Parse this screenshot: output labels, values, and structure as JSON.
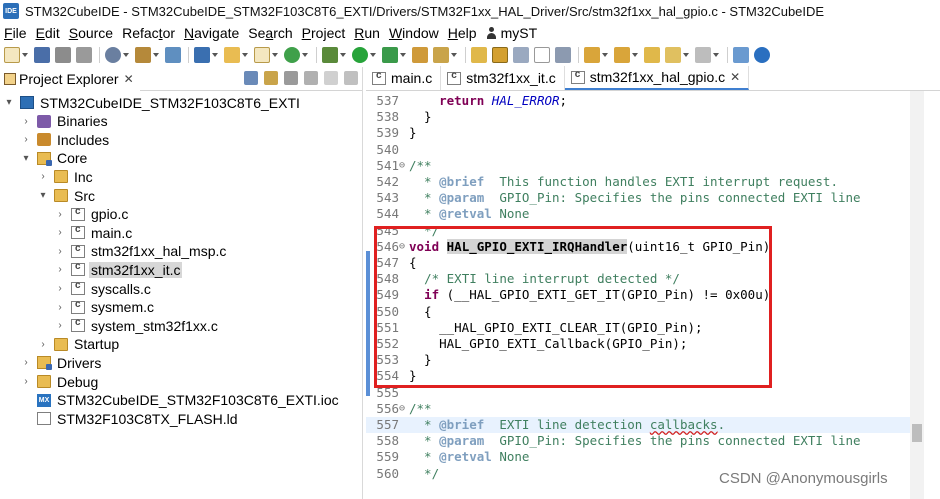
{
  "window": {
    "logo_text": "IDE",
    "title": "STM32CubeIDE - STM32CubeIDE_STM32F103C8T6_EXTI/Drivers/STM32F1xx_HAL_Driver/Src/stm32f1xx_hal_gpio.c - STM32CubeIDE"
  },
  "menu": [
    {
      "u": "F",
      "rest": "ile"
    },
    {
      "u": "E",
      "rest": "dit"
    },
    {
      "u": "S",
      "rest": "ource"
    },
    {
      "pre": "Refac",
      "u": "t",
      "rest": "or"
    },
    {
      "u": "N",
      "rest": "avigate"
    },
    {
      "pre": "Se",
      "u": "a",
      "rest": "rch"
    },
    {
      "u": "P",
      "rest": "roject"
    },
    {
      "u": "R",
      "rest": "un"
    },
    {
      "u": "W",
      "rest": "indow"
    },
    {
      "u": "H",
      "rest": "elp"
    }
  ],
  "menu_myst": "myST",
  "project_explorer": {
    "tab_label": "Project Explorer",
    "close": "✕",
    "tree": [
      {
        "label": "STM32CubeIDE_STM32F103C8T6_EXTI",
        "indent": 0,
        "arrow": "▾",
        "icon": "proj"
      },
      {
        "label": "Binaries",
        "indent": 1,
        "arrow": "›",
        "icon": "bin"
      },
      {
        "label": "Includes",
        "indent": 1,
        "arrow": "›",
        "icon": "inc"
      },
      {
        "label": "Core",
        "indent": 1,
        "arrow": "▾",
        "icon": "folder-src"
      },
      {
        "label": "Inc",
        "indent": 2,
        "arrow": "›",
        "icon": "folder"
      },
      {
        "label": "Src",
        "indent": 2,
        "arrow": "▾",
        "icon": "folder"
      },
      {
        "label": "gpio.c",
        "indent": 3,
        "arrow": "›",
        "icon": "cfile"
      },
      {
        "label": "main.c",
        "indent": 3,
        "arrow": "›",
        "icon": "cfile"
      },
      {
        "label": "stm32f1xx_hal_msp.c",
        "indent": 3,
        "arrow": "›",
        "icon": "cfile"
      },
      {
        "label": "stm32f1xx_it.c",
        "indent": 3,
        "arrow": "›",
        "icon": "cfile",
        "selected": true
      },
      {
        "label": "syscalls.c",
        "indent": 3,
        "arrow": "›",
        "icon": "cfile"
      },
      {
        "label": "sysmem.c",
        "indent": 3,
        "arrow": "›",
        "icon": "cfile"
      },
      {
        "label": "system_stm32f1xx.c",
        "indent": 3,
        "arrow": "›",
        "icon": "cfile"
      },
      {
        "label": "Startup",
        "indent": 2,
        "arrow": "›",
        "icon": "folder"
      },
      {
        "label": "Drivers",
        "indent": 1,
        "arrow": "›",
        "icon": "folder-src"
      },
      {
        "label": "Debug",
        "indent": 1,
        "arrow": "›",
        "icon": "folder"
      },
      {
        "label": "STM32CubeIDE_STM32F103C8T6_EXTI.ioc",
        "indent": 1,
        "arrow": "",
        "icon": "mx"
      },
      {
        "label": "STM32F103C8TX_FLASH.ld",
        "indent": 1,
        "arrow": "",
        "icon": "ld"
      }
    ]
  },
  "editor_tabs": [
    {
      "label": "main.c",
      "active": false
    },
    {
      "label": "stm32f1xx_it.c",
      "active": false
    },
    {
      "label": "stm32f1xx_hal_gpio.c",
      "active": true,
      "close": "✕"
    }
  ],
  "code": [
    {
      "n": "537",
      "f": "",
      "t": [
        [
          "    ",
          ""
        ],
        [
          "return ",
          "kw"
        ],
        [
          "HAL_ERROR",
          "it"
        ],
        [
          ";",
          ""
        ]
      ]
    },
    {
      "n": "538",
      "f": "",
      "t": [
        [
          "  }",
          ""
        ]
      ]
    },
    {
      "n": "539",
      "f": "",
      "t": [
        [
          "}",
          ""
        ]
      ]
    },
    {
      "n": "540",
      "f": "",
      "t": [
        [
          "",
          ""
        ]
      ]
    },
    {
      "n": "541",
      "f": "⊖",
      "t": [
        [
          "/**",
          "cm"
        ]
      ]
    },
    {
      "n": "542",
      "f": "",
      "t": [
        [
          "  * ",
          "cm"
        ],
        [
          "@brief",
          "tag"
        ],
        [
          "  This function handles EXTI interrupt request.",
          "cm"
        ]
      ]
    },
    {
      "n": "543",
      "f": "",
      "t": [
        [
          "  * ",
          "cm"
        ],
        [
          "@param",
          "tag"
        ],
        [
          "  GPIO_Pin: Specifies the pins connected EXTI line",
          "cm"
        ]
      ]
    },
    {
      "n": "544",
      "f": "",
      "t": [
        [
          "  * ",
          "cm"
        ],
        [
          "@retval",
          "tag"
        ],
        [
          " None",
          "cm"
        ]
      ]
    },
    {
      "n": "545",
      "f": "",
      "t": [
        [
          "  */",
          "cm"
        ]
      ]
    },
    {
      "n": "546",
      "f": "⊖",
      "t": [
        [
          "void ",
          "kw"
        ],
        [
          "HAL_GPIO_EXTI_IRQHandler",
          "fnhl"
        ],
        [
          "(uint16_t GPIO_Pin)",
          ""
        ]
      ]
    },
    {
      "n": "547",
      "f": "",
      "t": [
        [
          "{",
          ""
        ]
      ]
    },
    {
      "n": "548",
      "f": "",
      "t": [
        [
          "  ",
          ""
        ],
        [
          "/* EXTI line interrupt detected */",
          "cm"
        ]
      ]
    },
    {
      "n": "549",
      "f": "",
      "t": [
        [
          "  ",
          ""
        ],
        [
          "if",
          "kw"
        ],
        [
          " (__HAL_GPIO_EXTI_GET_IT(GPIO_Pin) != 0x00u)",
          ""
        ]
      ]
    },
    {
      "n": "550",
      "f": "",
      "t": [
        [
          "  {",
          ""
        ]
      ]
    },
    {
      "n": "551",
      "f": "",
      "t": [
        [
          "    __HAL_GPIO_EXTI_CLEAR_IT(GPIO_Pin);",
          ""
        ]
      ]
    },
    {
      "n": "552",
      "f": "",
      "t": [
        [
          "    HAL_GPIO_EXTI_Callback(GPIO_Pin);",
          ""
        ]
      ]
    },
    {
      "n": "553",
      "f": "",
      "t": [
        [
          "  }",
          ""
        ]
      ]
    },
    {
      "n": "554",
      "f": "",
      "t": [
        [
          "}",
          ""
        ]
      ]
    },
    {
      "n": "555",
      "f": "",
      "t": [
        [
          "",
          ""
        ]
      ]
    },
    {
      "n": "556",
      "f": "⊖",
      "t": [
        [
          "/**",
          "cm"
        ]
      ]
    },
    {
      "n": "557",
      "f": "",
      "cur": true,
      "t": [
        [
          "  * ",
          "cm"
        ],
        [
          "@brief",
          "tag"
        ],
        [
          "  EXTI line detection ",
          "cm"
        ],
        [
          "callbacks",
          "cm squig"
        ],
        [
          ".",
          "cm"
        ]
      ]
    },
    {
      "n": "558",
      "f": "",
      "t": [
        [
          "  * ",
          "cm"
        ],
        [
          "@param",
          "tag"
        ],
        [
          "  GPIO_Pin: Specifies the pins connected EXTI line",
          "cm"
        ]
      ]
    },
    {
      "n": "559",
      "f": "",
      "t": [
        [
          "  * ",
          "cm"
        ],
        [
          "@retval",
          "tag"
        ],
        [
          " None",
          "cm"
        ]
      ]
    },
    {
      "n": "560",
      "f": "",
      "t": [
        [
          "  */",
          "cm"
        ]
      ]
    }
  ],
  "watermark": "CSDN @Anonymousgirls",
  "colors": {
    "accent": "#3f7fd0",
    "highlight_box": "#e02020",
    "keyword": "#7f0055",
    "comment": "#3f7f5f"
  }
}
